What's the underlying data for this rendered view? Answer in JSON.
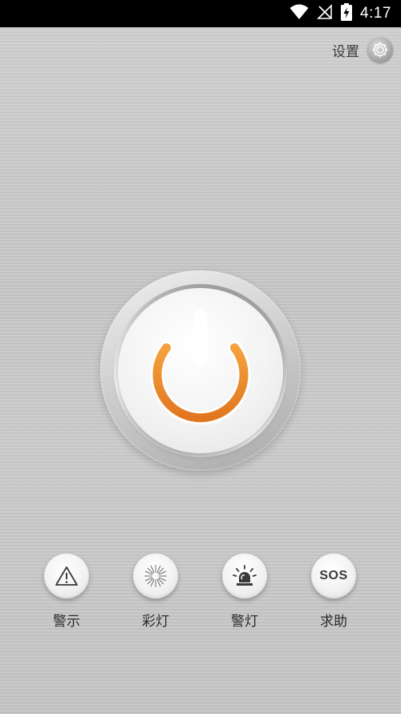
{
  "status_bar": {
    "time": "4:17",
    "icons": [
      "wifi-icon",
      "no-signal-icon",
      "battery-charging-icon"
    ]
  },
  "settings": {
    "label": "设置",
    "icon": "gear-icon"
  },
  "power_button": {
    "icon": "power-icon",
    "accent_color": "#e8872b"
  },
  "actions": [
    {
      "label": "警示",
      "icon": "warning-triangle-icon"
    },
    {
      "label": "彩灯",
      "icon": "sunburst-light-icon"
    },
    {
      "label": "警灯",
      "icon": "siren-icon"
    },
    {
      "label": "求助",
      "icon": "sos-icon",
      "icon_text": "SOS"
    }
  ]
}
